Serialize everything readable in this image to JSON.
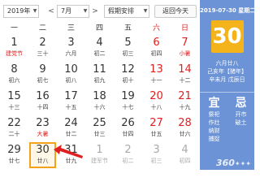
{
  "toolbar": {
    "year": "2019年",
    "month": "7月",
    "holiday": "假期安排",
    "prev": "<",
    "next": ">",
    "today_label": "返回今天"
  },
  "weekdays": [
    "一",
    "二",
    "三",
    "四",
    "五",
    "六",
    "日"
  ],
  "weeks": [
    [
      {
        "num": "1",
        "sub": "建党节",
        "sub_color": "red"
      },
      {
        "num": "2",
        "sub": "三十"
      },
      {
        "num": "3",
        "sub": "六月"
      },
      {
        "num": "4",
        "sub": "初二"
      },
      {
        "num": "5",
        "sub": "初三"
      },
      {
        "num": "6",
        "sub": "初四",
        "weekend": true
      },
      {
        "num": "7",
        "sub": "小暑",
        "weekend": true,
        "sub_color": "red"
      }
    ],
    [
      {
        "num": "8",
        "sub": "初六"
      },
      {
        "num": "9",
        "sub": "初七"
      },
      {
        "num": "10",
        "sub": "初八"
      },
      {
        "num": "11",
        "sub": "初九"
      },
      {
        "num": "12",
        "sub": "初十"
      },
      {
        "num": "13",
        "sub": "十一",
        "weekend": true
      },
      {
        "num": "14",
        "sub": "十二",
        "weekend": true
      }
    ],
    [
      {
        "num": "15",
        "sub": "十三"
      },
      {
        "num": "16",
        "sub": "十四"
      },
      {
        "num": "17",
        "sub": "十五"
      },
      {
        "num": "18",
        "sub": "十六"
      },
      {
        "num": "19",
        "sub": "十七"
      },
      {
        "num": "20",
        "sub": "十八",
        "weekend": true
      },
      {
        "num": "21",
        "sub": "十九",
        "weekend": true
      }
    ],
    [
      {
        "num": "22",
        "sub": "二十"
      },
      {
        "num": "23",
        "sub": "大暑",
        "sub_color": "red"
      },
      {
        "num": "24",
        "sub": "廿二"
      },
      {
        "num": "25",
        "sub": "廿三"
      },
      {
        "num": "26",
        "sub": "廿四"
      },
      {
        "num": "27",
        "sub": "廿五",
        "weekend": true
      },
      {
        "num": "28",
        "sub": "廿六",
        "weekend": true
      }
    ],
    [
      {
        "num": "29",
        "sub": "廿七"
      },
      {
        "num": "30",
        "sub": "廿八",
        "selected": true
      },
      {
        "num": "31",
        "sub": "廿九"
      },
      {
        "num": "1",
        "sub": "建军节",
        "other": true
      },
      {
        "num": "2",
        "sub": "初二",
        "other": true
      },
      {
        "num": "3",
        "sub": "初三",
        "other": true,
        "weekend": true
      },
      {
        "num": "4",
        "sub": "初四",
        "other": true,
        "weekend": true
      }
    ]
  ],
  "panel": {
    "date": "2019-07-30 星期二",
    "day": "30",
    "lunar_lines": [
      "六月廿八",
      "己亥年【猪年】",
      "辛未月 戊辰日"
    ],
    "yi_title": "宜",
    "yi_items": [
      "祭祀",
      "作灶",
      "纳财",
      "捕捉"
    ],
    "ji_title": "忌",
    "ji_items": [
      "开市",
      "破土"
    ],
    "panel_color": "#6b93d6",
    "day_badge_color": "#f5b31b"
  },
  "logo": "360"
}
